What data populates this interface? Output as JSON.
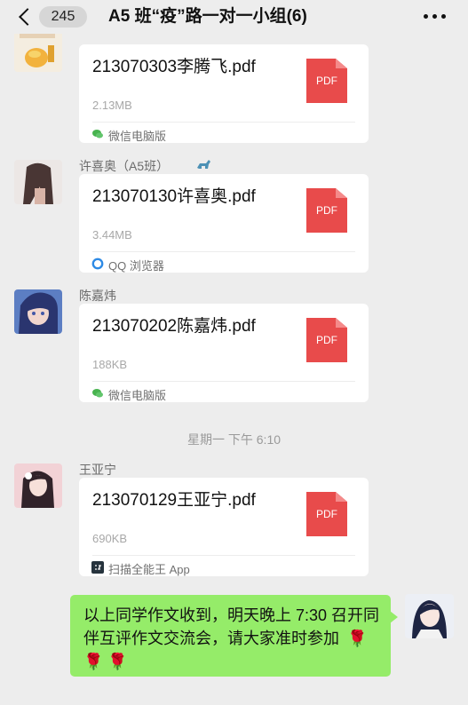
{
  "header": {
    "unread_count": "245",
    "title": "A5 班“疫”路一对一小组(6)"
  },
  "messages": [
    {
      "sender": "",
      "file_name": "213070303李腾飞.pdf",
      "file_size": "2.13MB",
      "source": "微信电脑版"
    },
    {
      "sender": "许喜奥（A5班）",
      "file_name": "213070130许喜奥.pdf",
      "file_size": "3.44MB",
      "source": "QQ 浏览器"
    },
    {
      "sender": "陈嘉炜",
      "file_name": "213070202陈嘉炜.pdf",
      "file_size": "188KB",
      "source": "微信电脑版"
    },
    {
      "sender": "王亚宁",
      "file_name": "213070129王亚宁.pdf",
      "file_size": "690KB",
      "source": "扫描全能王 App"
    }
  ],
  "time_divider": "星期一 下午 6:10",
  "my_message": {
    "text": "以上同学作文收到，明天晚上 7:30 召开同伴互评作文交流会，请大家准时参加",
    "flowers": "🌹 🌹 🌹"
  },
  "icons": {
    "pdf": "PDF"
  },
  "colors": {
    "background": "#ededed",
    "bubble": "#95ec69",
    "pdf": "#e84b4b"
  }
}
